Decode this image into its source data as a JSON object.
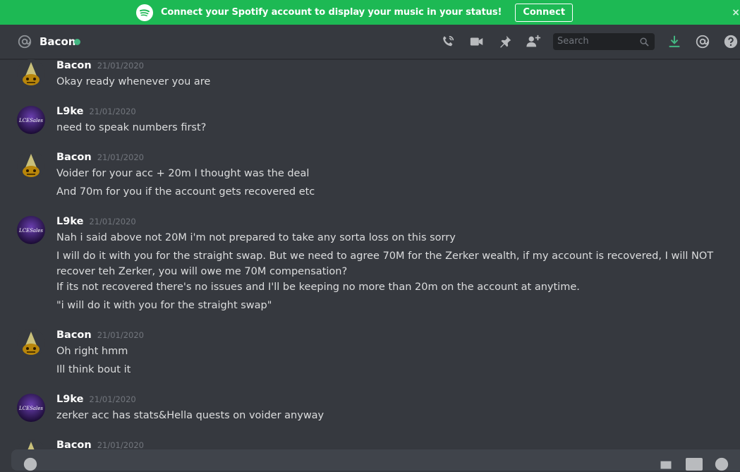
{
  "banner": {
    "text": "Connect your Spotify account to display your music in your status!",
    "connect_label": "Connect",
    "close_glyph": "×",
    "color": "#1db954"
  },
  "header": {
    "channel_name": "Bacon",
    "status_color": "#43b581",
    "search_placeholder": "Search"
  },
  "messages": [
    {
      "author": "Bacon",
      "timestamp": "21/01/2020",
      "avatar": "party-hat-avatar",
      "lines": [
        "Okay ready whenever you are"
      ]
    },
    {
      "author": "L9ke",
      "timestamp": "21/01/2020",
      "avatar": "lcesales-avatar",
      "lines": [
        "need to speak numbers first?"
      ]
    },
    {
      "author": "Bacon",
      "timestamp": "21/01/2020",
      "avatar": "party-hat-avatar",
      "lines": [
        "Voider for your acc + 20m I thought was the deal",
        "And 70m for you if the account gets recovered etc"
      ]
    },
    {
      "author": "L9ke",
      "timestamp": "21/01/2020",
      "avatar": "lcesales-avatar",
      "lines": [
        "Nah i said above not 20M i'm not prepared to take any sorta loss on this sorry",
        "I will do it with you for the straight swap. But we need to agree 70M for the Zerker wealth, if my account is recovered, I will NOT recover teh Zerker, you will owe me 70M compensation?",
        "If its not recovered there's no issues and I'll be keeping no more than 20m on the account at anytime.",
        "\"i will do it with you for the straight swap\""
      ]
    },
    {
      "author": "Bacon",
      "timestamp": "21/01/2020",
      "avatar": "party-hat-avatar",
      "lines": [
        "Oh right hmm",
        "Ill think bout it"
      ]
    },
    {
      "author": "L9ke",
      "timestamp": "21/01/2020",
      "avatar": "lcesales-avatar",
      "lines": [
        "zerker acc has stats&Hella quests on voider anyway"
      ]
    },
    {
      "author": "Bacon",
      "timestamp": "21/01/2020",
      "avatar": "party-hat-avatar",
      "lines": []
    }
  ],
  "avatar_text": {
    "lcesales": "LCESales"
  }
}
